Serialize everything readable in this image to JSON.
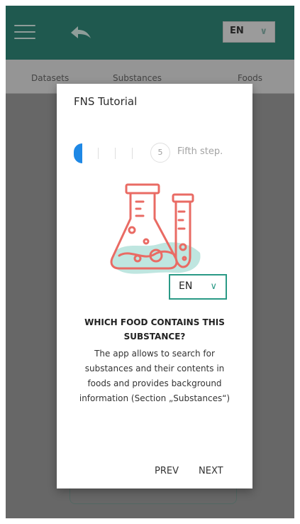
{
  "appbar": {
    "language": "EN"
  },
  "tabs": [
    {
      "label": "Datasets"
    },
    {
      "label": "Substances"
    },
    {
      "label": "Foods"
    }
  ],
  "dialog": {
    "title": "FNS Tutorial",
    "stepper": {
      "current_step_number": "5",
      "current_step_label": "Fifth step."
    },
    "language_select": {
      "value": "EN"
    },
    "heading": "WHICH FOOD CONTAINS THIS SUBSTANCE?",
    "body": "The app allows to search for substances and their contents in foods and provides background information (Section „Substances“)",
    "prev_label": "PREV",
    "next_label": "NEXT"
  },
  "icons": {
    "menu": "hamburger-menu-icon",
    "back": "back-arrow-icon",
    "chevron": "chevron-down-icon",
    "illustration": "lab-flasks-icon"
  },
  "colors": {
    "appbar": "#1a7868",
    "step_active": "#1e88e5",
    "select_border": "#2a9a86",
    "flask_stroke": "#e96b64",
    "flask_liquid": "#bfe6e0"
  }
}
